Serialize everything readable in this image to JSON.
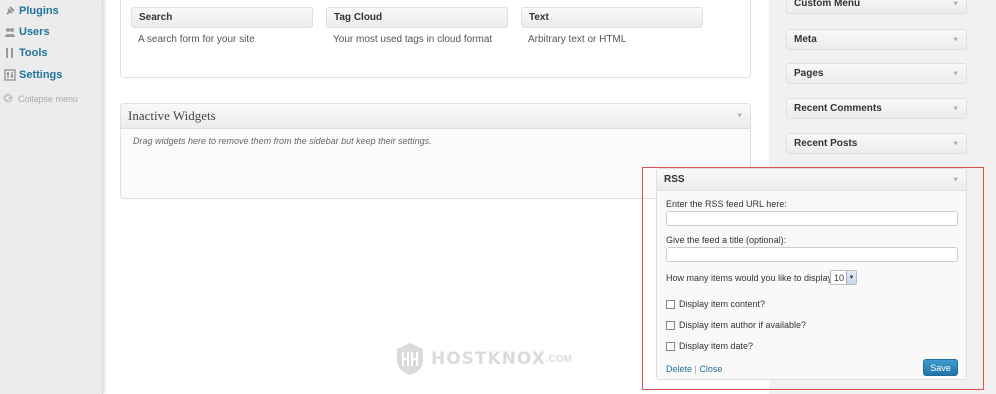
{
  "admin_menu": {
    "items": [
      {
        "label": "Plugins",
        "icon": "plug-icon"
      },
      {
        "label": "Users",
        "icon": "users-icon"
      },
      {
        "label": "Tools",
        "icon": "tools-icon"
      },
      {
        "label": "Settings",
        "icon": "settings-icon"
      }
    ],
    "collapse_label": "Collapse menu"
  },
  "available_widgets": [
    {
      "title": "Search",
      "description": "A search form for your site"
    },
    {
      "title": "Tag Cloud",
      "description": "Your most used tags in cloud format"
    },
    {
      "title": "Text",
      "description": "Arbitrary text or HTML"
    }
  ],
  "inactive_widgets": {
    "title": "Inactive Widgets",
    "description": "Drag widgets here to remove them from the sidebar but keep their settings."
  },
  "sidebar_widgets": [
    "Custom Menu",
    "Meta",
    "Pages",
    "Recent Comments",
    "Recent Posts"
  ],
  "rss_widget": {
    "title": "RSS",
    "url_label": "Enter the RSS feed URL here:",
    "url_value": "",
    "title_label": "Give the feed a title (optional):",
    "title_value": "",
    "count_label": "How many items would you like to display?",
    "count_value": "10",
    "options": [
      {
        "label": "Display item content?",
        "checked": false
      },
      {
        "label": "Display item author if available?",
        "checked": false
      },
      {
        "label": "Display item date?",
        "checked": false
      }
    ],
    "delete_label": "Delete",
    "separator": "|",
    "close_label": "Close",
    "save_label": "Save"
  },
  "watermark": {
    "text": "HOSTKNOX",
    "suffix": ".COM"
  },
  "colors": {
    "link": "#21759b",
    "highlight": "#d9534f",
    "save_button": "#2a82b9"
  }
}
